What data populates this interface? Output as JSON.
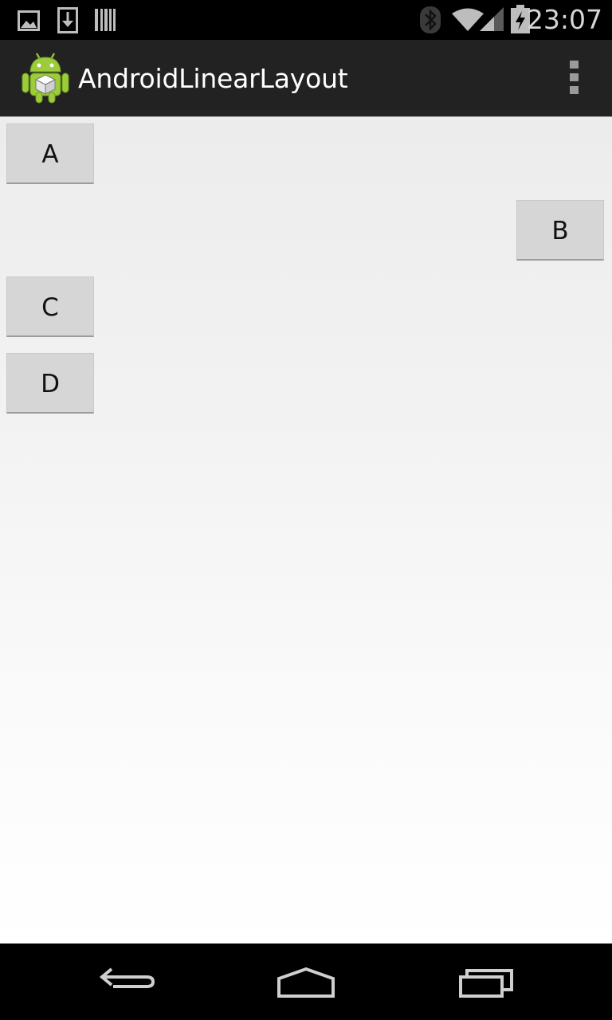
{
  "status_bar": {
    "time": "23:07",
    "notification_icons": [
      "gallery-icon",
      "download-icon",
      "barcode-icon"
    ],
    "system_icons": [
      "bluetooth-icon",
      "wifi-icon",
      "cellular-signal-icon",
      "battery-charging-icon"
    ]
  },
  "action_bar": {
    "title": "AndroidLinearLayout",
    "app_icon": "android-robot-icon",
    "menu_icon": "overflow-menu-icon"
  },
  "content": {
    "buttons": [
      {
        "label": "A",
        "gravity": "left"
      },
      {
        "label": "B",
        "gravity": "right"
      },
      {
        "label": "C",
        "gravity": "left"
      },
      {
        "label": "D",
        "gravity": "left"
      }
    ]
  },
  "nav_bar": {
    "icons": [
      "back-icon",
      "home-icon",
      "recent-apps-icon"
    ]
  },
  "colors": {
    "status_bar_bg": "#000000",
    "action_bar_bg": "#222222",
    "button_bg": "#d6d6d6",
    "content_bg_top": "#ececec",
    "content_bg_bottom": "#ffffff"
  }
}
